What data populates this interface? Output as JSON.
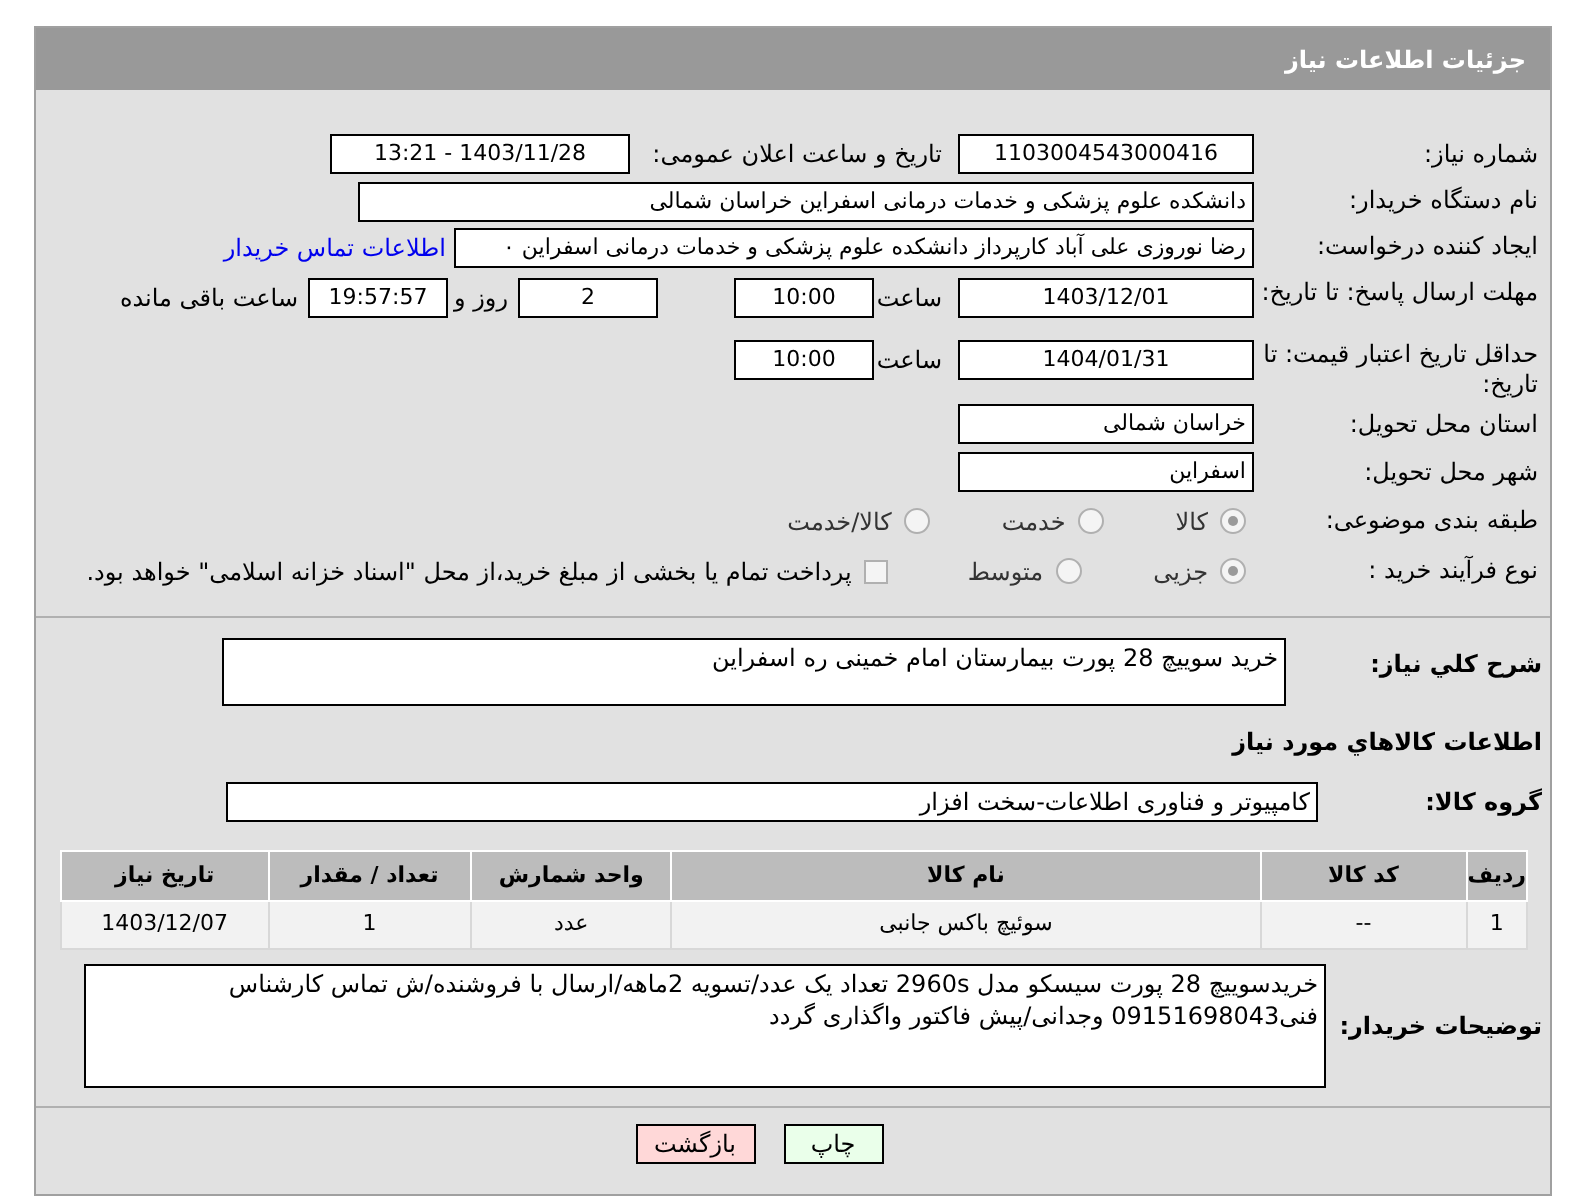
{
  "header": {
    "title": "جزئیات اطلاعات نیاز"
  },
  "need_number": {
    "label": "شماره نیاز:",
    "value": "1103004543000416"
  },
  "announce": {
    "label": "تاریخ و ساعت اعلان عمومی:",
    "value": "1403/11/28 - 13:21"
  },
  "buyer_org": {
    "label": "نام دستگاه خریدار:",
    "value": "دانشکده علوم پزشکی و خدمات درمانی اسفراین خراسان شمالی"
  },
  "requester": {
    "label": "ایجاد کننده درخواست:",
    "value": "رضا نوروزی علی آباد کارپرداز  دانشکده علوم پزشکی و خدمات درمانی اسفراین ۰",
    "link": "اطلاعات تماس خریدار"
  },
  "reply_deadline": {
    "label": "مهلت ارسال پاسخ: تا تاریخ:",
    "date": "1403/12/01",
    "time_label": "ساعت",
    "time": "10:00",
    "days": "2",
    "days_label": "روز و",
    "remaining": "19:57:57",
    "remaining_label": "ساعت باقی مانده"
  },
  "price_validity": {
    "label": "حداقل تاریخ اعتبار قیمت: تا تاریخ:",
    "date": "1404/01/31",
    "time_label": "ساعت",
    "time": "10:00"
  },
  "province": {
    "label": "استان محل تحویل:",
    "value": "خراسان شمالی"
  },
  "city": {
    "label": "شهر محل تحویل:",
    "value": "اسفراین"
  },
  "category": {
    "label": "طبقه بندی موضوعی:",
    "options": [
      {
        "label": "کالا",
        "selected": true
      },
      {
        "label": "خدمت",
        "selected": false
      },
      {
        "label": "کالا/خدمت",
        "selected": false
      }
    ]
  },
  "process": {
    "label": "نوع فرآیند خرید :",
    "options": [
      {
        "label": "جزیی",
        "selected": true
      },
      {
        "label": "متوسط",
        "selected": false
      }
    ],
    "treasury": {
      "checked": false,
      "text": "پرداخت تمام یا بخشی از مبلغ خرید،از محل \"اسناد خزانه اسلامی\" خواهد بود."
    }
  },
  "description": {
    "label": "شرح کلي نياز:",
    "value": "خرید سوییچ 28 پورت بیمارستان امام خمینی ره اسفراین"
  },
  "goods_heading": "اطلاعات کالاهاي مورد نياز",
  "goods_group": {
    "label": "گروه کالا:",
    "value": "کامپیوتر و فناوری اطلاعات-سخت افزار"
  },
  "table": {
    "columns": [
      "ردیف",
      "کد کالا",
      "نام کالا",
      "واحد شمارش",
      "تعداد / مقدار",
      "تاریخ نیاز"
    ],
    "rows": [
      [
        "1",
        "--",
        "سوئیچ باکس جانبی",
        "عدد",
        "1",
        "1403/12/07"
      ]
    ]
  },
  "buyer_notes": {
    "label": "توضیحات خریدار:",
    "value": "خریدسوییچ 28 پورت سیسکو مدل 2960s تعداد یک عدد/تسویه 2ماهه/ارسال با فروشنده/ش تماس کارشناس فنی09151698043 وجدانی/پیش فاکتور واگذاری گردد"
  },
  "buttons": [
    {
      "label": "چاپ",
      "kind": "print"
    },
    {
      "label": "بازگشت",
      "kind": "back"
    }
  ]
}
